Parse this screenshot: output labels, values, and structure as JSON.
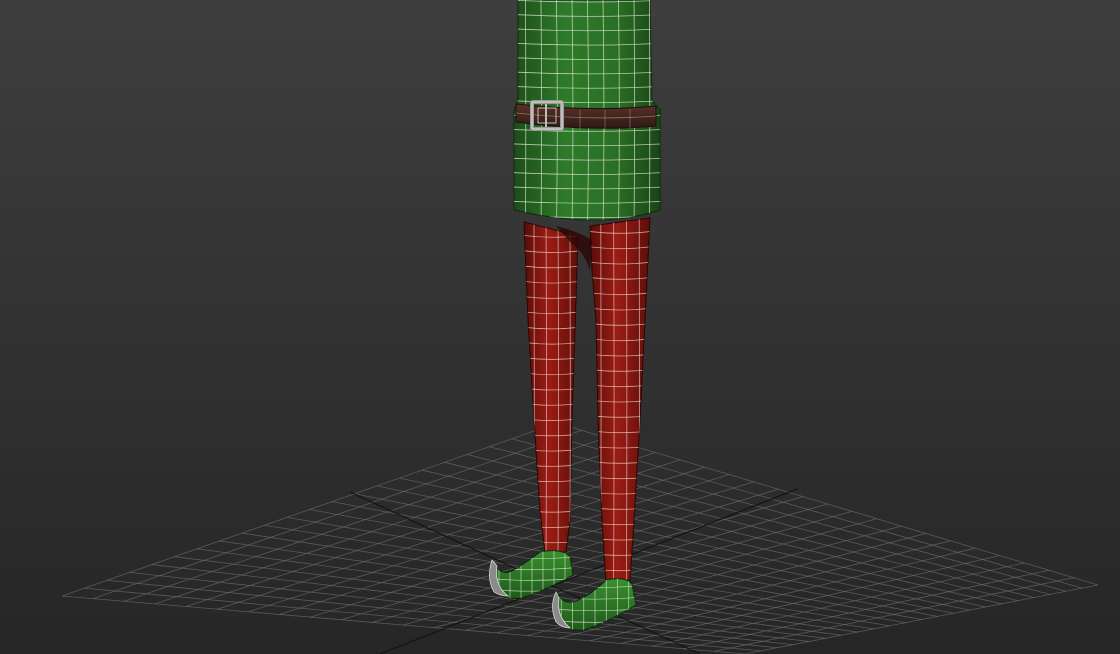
{
  "viewport": {
    "shading": "smooth-highlights-edged-faces",
    "background_top_color": "#3e3e3e",
    "background_bottom_color": "#262626"
  },
  "scene": {
    "home_grid": {
      "visible": true,
      "line_color": "#6e6e6e",
      "axis_color": "#111111"
    },
    "objects": [
      {
        "name": "elf-tunic",
        "color": "#2f7a2a",
        "wire_color": "#d8e8d0"
      },
      {
        "name": "elf-belt",
        "color": "#4a2a22",
        "wire_color": "#bfa9a0"
      },
      {
        "name": "elf-belt-buckle",
        "color": "#8c8c8c",
        "wire_color": "#e0e0e0"
      },
      {
        "name": "elf-leg-left",
        "color": "#8a1a12",
        "wire_color": "#f0d0c8"
      },
      {
        "name": "elf-leg-right",
        "color": "#8a1a12",
        "wire_color": "#f0d0c8"
      },
      {
        "name": "elf-shoe-left",
        "color": "#2e7a26",
        "wire_color": "#d8ead0"
      },
      {
        "name": "elf-shoe-right",
        "color": "#2e7a26",
        "wire_color": "#d8ead0"
      }
    ]
  }
}
